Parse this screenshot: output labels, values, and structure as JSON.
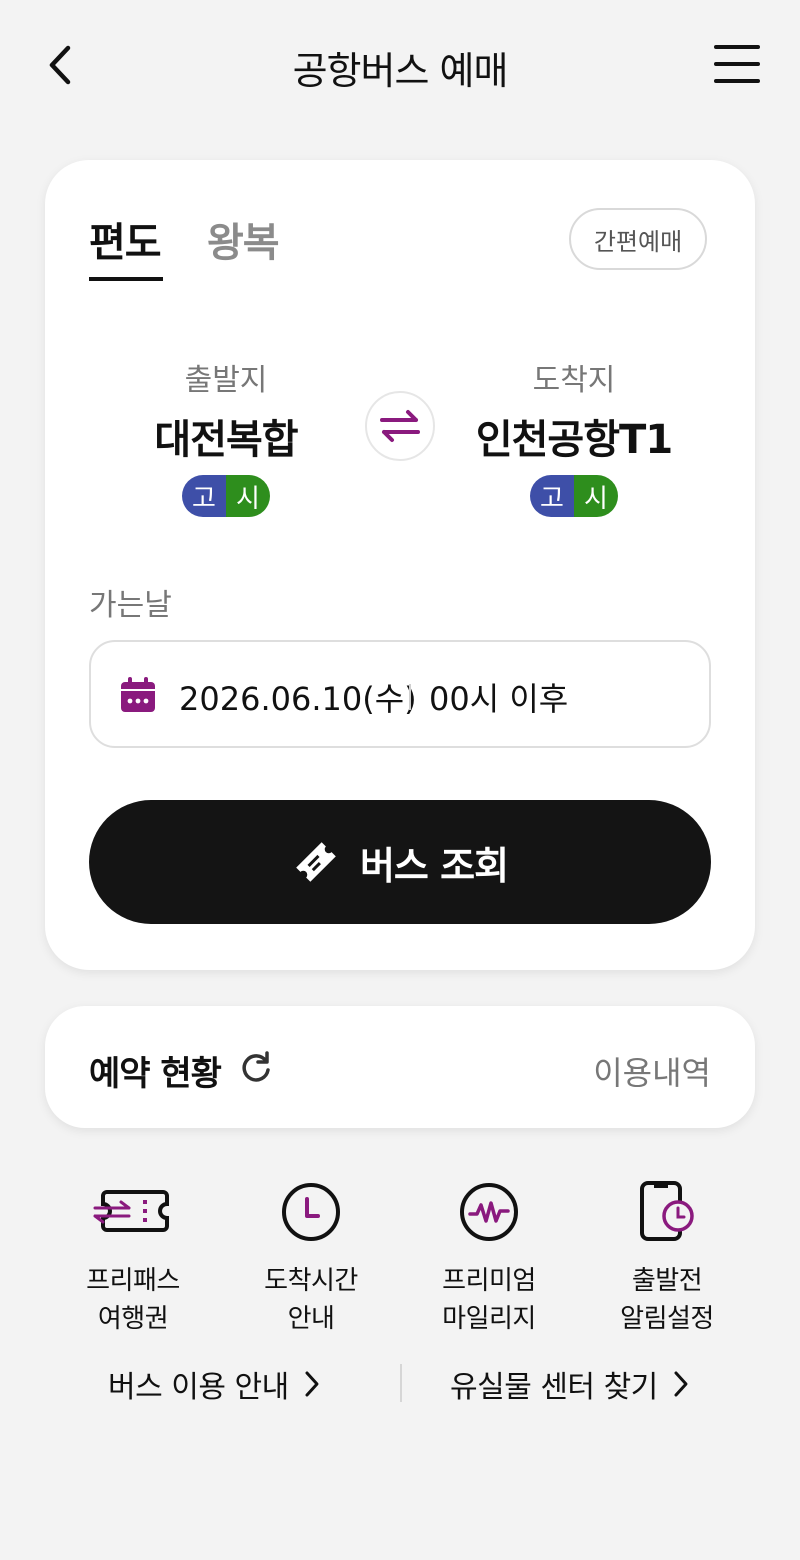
{
  "header": {
    "title": "공항버스 예매"
  },
  "tabs": [
    {
      "label": "편도"
    },
    {
      "label": "왕복"
    }
  ],
  "quick_booking": "간편예매",
  "departure": {
    "label": "출발지",
    "name": "대전복합",
    "tags": [
      "고",
      "시"
    ]
  },
  "arrival": {
    "label": "도착지",
    "name": "인천공항T1",
    "tags": [
      "고",
      "시"
    ]
  },
  "date": {
    "label": "가는날",
    "value": "2026.06.10(수)",
    "time": "00시 이후"
  },
  "search_button": "버스 조회",
  "reservation": {
    "title": "예약 현황",
    "history_link": "이용내역"
  },
  "quick_menu": [
    {
      "line1": "프리패스",
      "line2": "여행권",
      "icon": "freepass-ticket-icon"
    },
    {
      "line1": "도착시간",
      "line2": "안내",
      "icon": "clock-icon"
    },
    {
      "line1": "프리미엄",
      "line2": "마일리지",
      "icon": "mileage-icon"
    },
    {
      "line1": "출발전",
      "line2": "알림설정",
      "icon": "phone-alarm-icon"
    }
  ],
  "bottom_links": {
    "guide": "버스 이용 안내",
    "lost_found": "유실물 센터 찾기"
  },
  "colors": {
    "accent": "#8a1a7e",
    "express_tag": "#3e4fa8",
    "intercity_tag": "#2e8e1d",
    "button_dark": "#141414"
  }
}
